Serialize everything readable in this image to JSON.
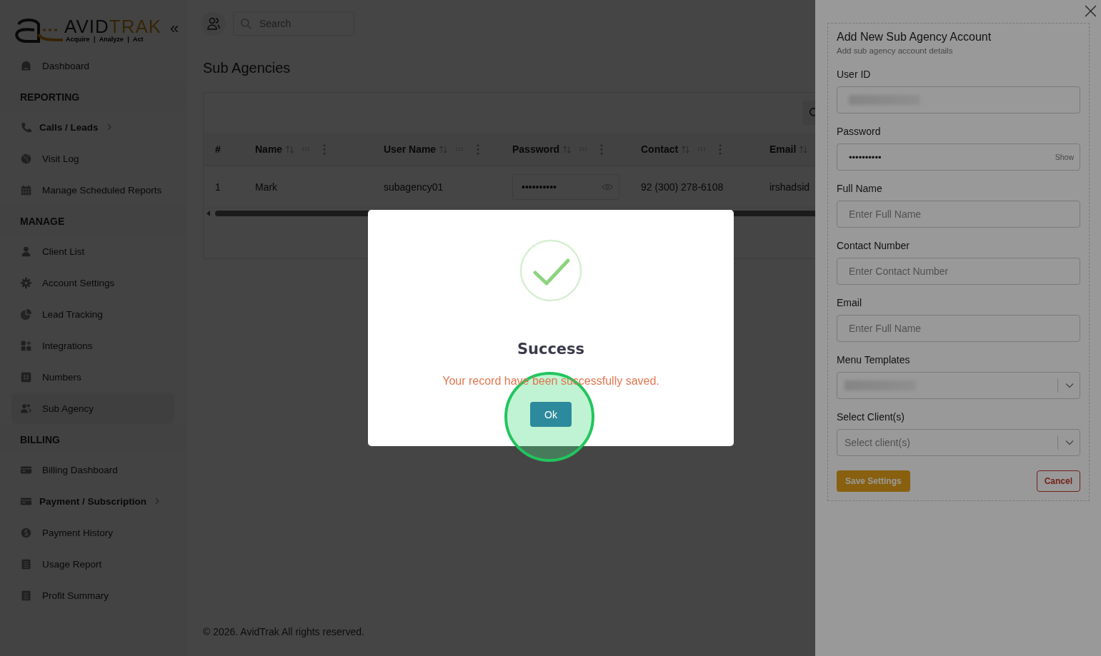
{
  "sidebar": {
    "logo": {
      "word_a": "AVID",
      "word_b": "TRAK",
      "tagline": "Acquire | Analyze | Act",
      "collapse": "«"
    },
    "sections": [
      {
        "items": [
          {
            "label": "Dashboard",
            "selected": false,
            "submenu": false
          }
        ]
      },
      {
        "title": "REPORTING",
        "items": [
          {
            "label": "Calls / Leads",
            "selected": false,
            "submenu": true
          },
          {
            "label": "Visit Log",
            "selected": false,
            "submenu": false
          },
          {
            "label": "Manage Scheduled Reports",
            "selected": false,
            "submenu": false
          }
        ]
      },
      {
        "title": "MANAGE",
        "items": [
          {
            "label": "Client List",
            "selected": false,
            "submenu": false
          },
          {
            "label": "Account Settings",
            "selected": false,
            "submenu": false
          },
          {
            "label": "Lead Tracking",
            "selected": false,
            "submenu": false
          },
          {
            "label": "Integrations",
            "selected": false,
            "submenu": false
          },
          {
            "label": "Numbers",
            "selected": false,
            "submenu": false
          },
          {
            "label": "Sub Agency",
            "selected": true,
            "submenu": false
          }
        ]
      },
      {
        "title": "BILLING",
        "items": [
          {
            "label": "Billing Dashboard",
            "selected": false,
            "submenu": false
          },
          {
            "label": "Payment / Subscription",
            "selected": false,
            "submenu": true
          },
          {
            "label": "Payment History",
            "selected": false,
            "submenu": false
          },
          {
            "label": "Usage Report",
            "selected": false,
            "submenu": false
          },
          {
            "label": "Profit Summary",
            "selected": false,
            "submenu": false
          }
        ]
      }
    ]
  },
  "topbar": {
    "search": {
      "placeholder": "Search"
    }
  },
  "page": {
    "title": "Sub Agencies",
    "table": {
      "columns": [
        "#",
        "Name",
        "User Name",
        "Password",
        "Contact",
        "Email"
      ],
      "rows": [
        {
          "cells": [
            "1",
            "Mark",
            "subagency01",
            "••••••••••",
            "92 (300) 278-6108",
            "irshadsid"
          ]
        }
      ]
    },
    "footer": "© 2026. AvidTrak All rights reserved."
  },
  "drawer": {
    "title": "Add New Sub Agency Account",
    "subtitle": "Add sub agency account details",
    "fields": [
      {
        "label": "User ID",
        "kind": "text",
        "redacted": true
      },
      {
        "label": "Password",
        "kind": "password",
        "value": "••••••••••",
        "toggle": "Show"
      },
      {
        "label": "Full Name",
        "kind": "text",
        "redacted": false,
        "placeholder": "Enter Full Name"
      },
      {
        "label": "Contact Number",
        "kind": "text",
        "redacted": false,
        "placeholder": "Enter Contact Number"
      },
      {
        "label": "Email",
        "kind": "text",
        "redacted": false,
        "placeholder": "Enter Full Name"
      },
      {
        "label": "Menu Templates",
        "kind": "select",
        "redacted": true
      },
      {
        "label": "Select Client(s)",
        "kind": "select",
        "redacted": false,
        "placeholder": "Select client(s)"
      }
    ],
    "save": "Save Settings",
    "cancel": "Cancel"
  },
  "dialog": {
    "title": "Success",
    "message": "Your record have been successfully saved.",
    "ok": "Ok"
  }
}
